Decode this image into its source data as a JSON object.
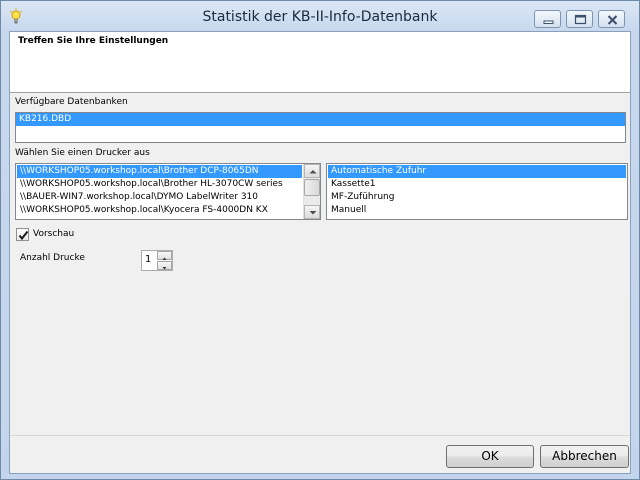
{
  "window": {
    "title": "Statistik der KB-II-Info-Datenbank"
  },
  "header": {
    "text": "Treffen Sie Ihre Einstellungen"
  },
  "databases": {
    "label": "Verfügbare Datenbanken",
    "items": [
      "KB216.DBD"
    ],
    "selected_index": 0
  },
  "printers": {
    "label": "Wählen Sie einen Drucker aus",
    "items": [
      "\\\\WORKSHOP05.workshop.local\\Brother DCP-8065DN",
      "\\\\WORKSHOP05.workshop.local\\Brother HL-3070CW series",
      "\\\\BAUER-WIN7.workshop.local\\DYMO LabelWriter 310",
      "\\\\WORKSHOP05.workshop.local\\Kyocera FS-4000DN KX"
    ],
    "selected_index": 0
  },
  "paper_source": {
    "items": [
      "Automatische Zufuhr",
      "Kassette1",
      "MF-Zuführung",
      "Manuell"
    ],
    "selected_index": 0
  },
  "preview": {
    "label": "Vorschau",
    "checked": true
  },
  "copies": {
    "label": "Anzahl Drucke",
    "value": "1"
  },
  "buttons": {
    "ok": "OK",
    "cancel": "Abbrechen"
  },
  "colors": {
    "selection": "#3399ff",
    "title_bar": "#c7d8ee"
  },
  "icons": {
    "app": "lightbulb-icon"
  }
}
